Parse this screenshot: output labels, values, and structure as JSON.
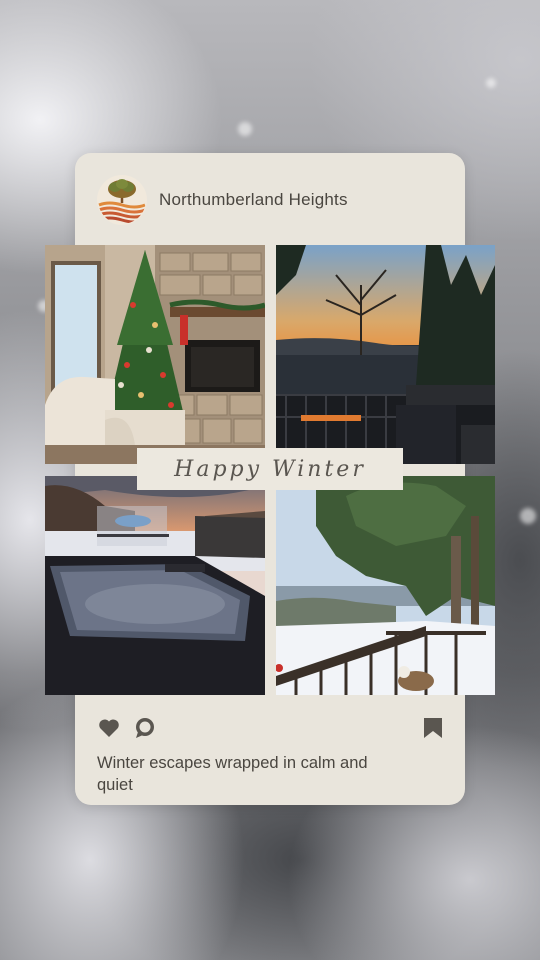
{
  "post": {
    "account_name": "Northumberland Heights",
    "logo_icon": "tree-sunset-logo-icon",
    "banner_text": "Happy Winter",
    "caption": "Winter escapes wrapped in calm and quiet",
    "actions": [
      "heart-icon",
      "comment-icon",
      "bookmark-icon"
    ],
    "photos": [
      "Living room with decorated Christmas tree and stone fireplace",
      "Deck overlooking valley at sunset",
      "Steaming hot tub in snow",
      "Snowy deck with evergreen tree and dog"
    ]
  },
  "colors": {
    "card": "#e9e5dc",
    "text": "#4a4640",
    "logo_orange": "#d9723a",
    "logo_brown": "#8a5a2c"
  }
}
